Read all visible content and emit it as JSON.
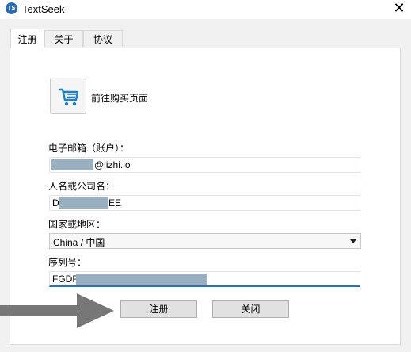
{
  "window": {
    "title": "TextSeek",
    "icon": "textseek-app-icon",
    "icon_text": "TS",
    "close_icon": "close-icon"
  },
  "tabs": [
    {
      "label": "注册",
      "active": true
    },
    {
      "label": "关于",
      "active": false
    },
    {
      "label": "协议",
      "active": false
    }
  ],
  "purchase": {
    "icon": "shopping-cart-icon",
    "label": "前往购买页面"
  },
  "form": {
    "email": {
      "label": "电子邮箱（账户）：",
      "value_suffix": "@lizhi.io"
    },
    "name": {
      "label": "人名或公司名：",
      "value_prefix": "D",
      "value_suffix": "EE"
    },
    "country": {
      "label": "国家或地区：",
      "selected": "China / 中国"
    },
    "serial": {
      "label": "序列号：",
      "value_prefix": "FGDF"
    }
  },
  "buttons": {
    "register": "注册",
    "close": "关闭"
  },
  "colors": {
    "focus_underline": "#2e6fb6",
    "redaction": "#9ab0be",
    "overlay_arrow": "#777777"
  }
}
